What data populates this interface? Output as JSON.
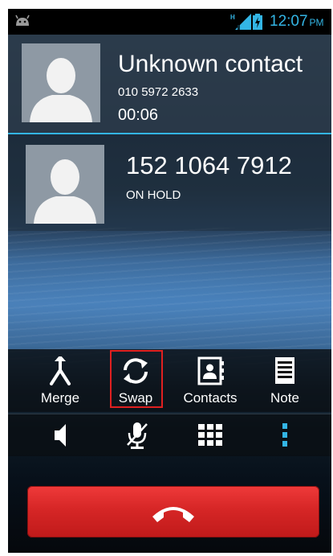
{
  "status_bar": {
    "time": "12:07",
    "ampm": "PM",
    "signal_indicator": "H",
    "icons": [
      "android-notification-icon",
      "signal-icon",
      "battery-charging-icon"
    ],
    "accent_color": "#33b5e5"
  },
  "active_call": {
    "name": "Unknown contact",
    "number": "010 5972 2633",
    "duration": "00:06"
  },
  "held_call": {
    "number": "152 1064 7912",
    "status": "ON HOLD"
  },
  "actions": {
    "merge": "Merge",
    "swap": "Swap",
    "contacts": "Contacts",
    "note": "Note",
    "highlight_color": "#e02020"
  },
  "controls": {
    "icons": [
      "speaker-icon",
      "mute-mic-icon",
      "dialpad-icon",
      "more-options-icon"
    ]
  },
  "end_call": {
    "icon": "end-call-icon",
    "color": "#d62626"
  }
}
